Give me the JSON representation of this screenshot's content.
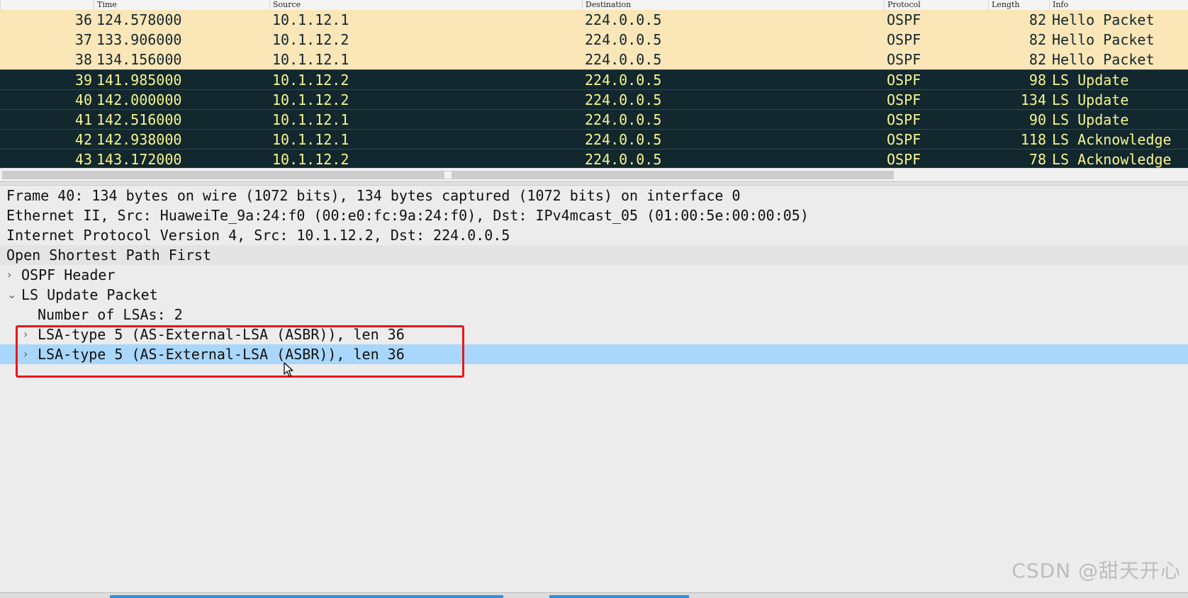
{
  "columns": {
    "time": "Time",
    "source": "Source",
    "destination": "Destination",
    "protocol": "Protocol",
    "length": "Length",
    "info": "Info"
  },
  "packets": [
    {
      "no": "36",
      "time": "124.578000",
      "source": "10.1.12.1",
      "destination": "224.0.0.5",
      "protocol": "OSPF",
      "length": "82",
      "info": "Hello Packet"
    },
    {
      "no": "37",
      "time": "133.906000",
      "source": "10.1.12.2",
      "destination": "224.0.0.5",
      "protocol": "OSPF",
      "length": "82",
      "info": "Hello Packet"
    },
    {
      "no": "38",
      "time": "134.156000",
      "source": "10.1.12.1",
      "destination": "224.0.0.5",
      "protocol": "OSPF",
      "length": "82",
      "info": "Hello Packet"
    },
    {
      "no": "39",
      "time": "141.985000",
      "source": "10.1.12.2",
      "destination": "224.0.0.5",
      "protocol": "OSPF",
      "length": "98",
      "info": "LS Update"
    },
    {
      "no": "40",
      "time": "142.000000",
      "source": "10.1.12.2",
      "destination": "224.0.0.5",
      "protocol": "OSPF",
      "length": "134",
      "info": "LS Update"
    },
    {
      "no": "41",
      "time": "142.516000",
      "source": "10.1.12.1",
      "destination": "224.0.0.5",
      "protocol": "OSPF",
      "length": "90",
      "info": "LS Update"
    },
    {
      "no": "42",
      "time": "142.938000",
      "source": "10.1.12.1",
      "destination": "224.0.0.5",
      "protocol": "OSPF",
      "length": "118",
      "info": "LS Acknowledge"
    },
    {
      "no": "43",
      "time": "143.172000",
      "source": "10.1.12.2",
      "destination": "224.0.0.5",
      "protocol": "OSPF",
      "length": "78",
      "info": "LS Acknowledge"
    }
  ],
  "detail": {
    "frame": "Frame 40: 134 bytes on wire (1072 bits), 134 bytes captured (1072 bits) on interface 0",
    "ethernet": "Ethernet II, Src: HuaweiTe_9a:24:f0 (00:e0:fc:9a:24:f0), Dst: IPv4mcast_05 (01:00:5e:00:00:05)",
    "ip": "Internet Protocol Version 4, Src: 10.1.12.2, Dst: 224.0.0.5",
    "ospf": "Open Shortest Path First",
    "ospf_header": "OSPF Header",
    "ls_update": "LS Update Packet",
    "num_lsas": "Number of LSAs: 2",
    "lsa_1": "LSA-type 5 (AS-External-LSA (ASBR)), len 36",
    "lsa_2": "LSA-type 5 (AS-External-LSA (ASBR)), len 36"
  },
  "icons": {
    "collapsed": "chevron-right-icon",
    "expanded": "chevron-down-icon",
    "cursor": "mouse-cursor-icon"
  },
  "colors": {
    "hello_row_bg": "#fbe6b8",
    "ls_row_bg": "#12272e",
    "ls_row_fg": "#f7f58c",
    "selected_bg": "#a9d7fb",
    "highlight_box": "#e8171b"
  },
  "watermark": "CSDN @甜天开心"
}
